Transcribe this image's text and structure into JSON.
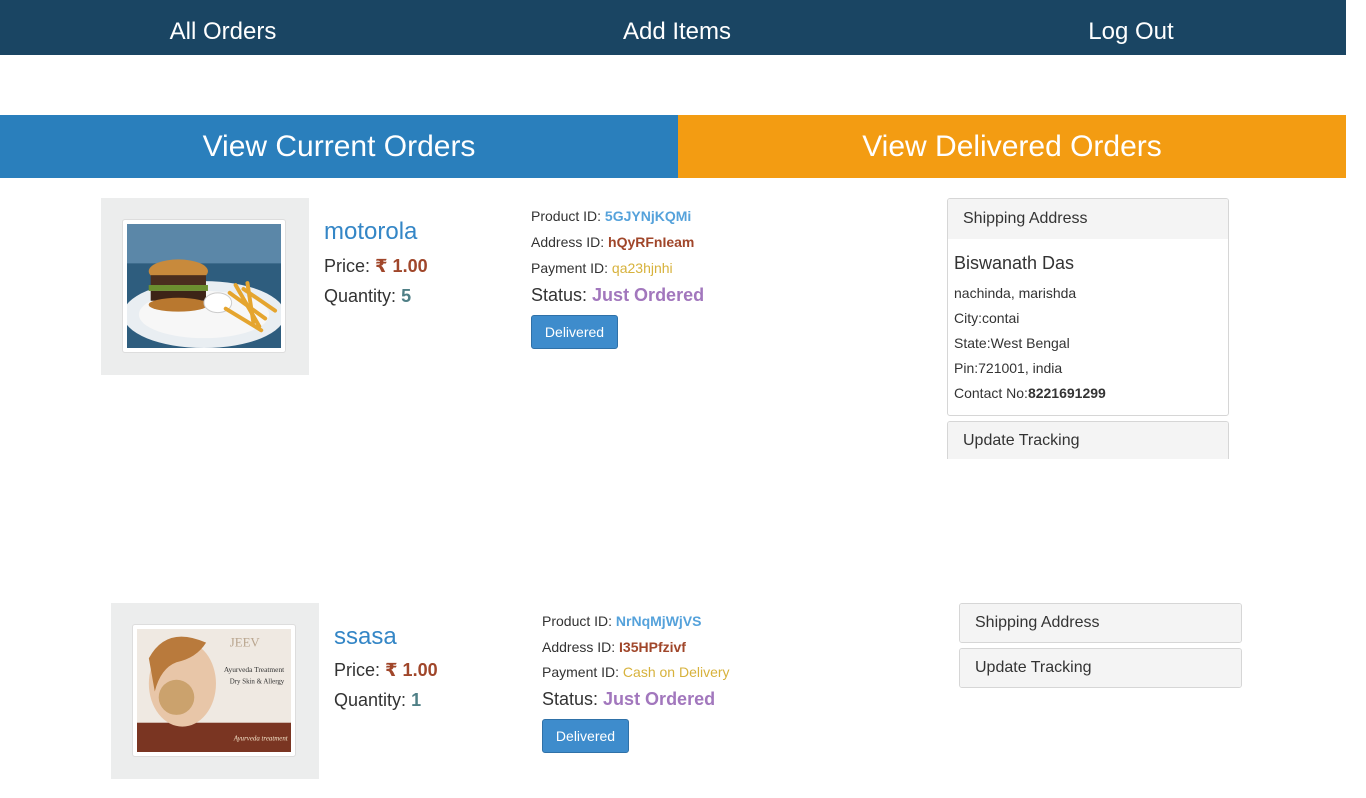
{
  "nav": {
    "all_orders": "All Orders",
    "add_items": "Add Items",
    "log_out": "Log Out"
  },
  "tabs": {
    "current": "View Current Orders",
    "delivered": "View Delivered Orders"
  },
  "labels": {
    "price": "Price:",
    "quantity": "Quantity:",
    "product_id": "Product ID:",
    "address_id": "Address ID:",
    "payment_id": "Payment ID:",
    "status": "Status:",
    "delivered_button": "Delivered",
    "shipping_address": "Shipping Address",
    "update_tracking": "Update Tracking"
  },
  "orders": [
    {
      "name": "motorola",
      "price": "₹ 1.00",
      "quantity": "5",
      "product_id": "5GJYNjKQMi",
      "address_id": "hQyRFnIeam",
      "payment_id": "qa23hjnhi",
      "status": "Just Ordered",
      "image_icon": "burger-fries-photo",
      "shipping": {
        "name": "Biswanath Das",
        "street": "nachinda, marishda",
        "city": "City:contai",
        "state": "State:West Bengal",
        "pin": "Pin:721001, india",
        "contact_label": "Contact No:",
        "contact": "8221691299"
      }
    },
    {
      "name": "ssasa",
      "price": "₹ 1.00",
      "quantity": "1",
      "product_id": "NrNqMjWjVS",
      "address_id": "I35HPfzivf",
      "payment_id": "Cash on Delivery",
      "status": "Just Ordered",
      "image_icon": "ayurveda-poster-photo",
      "image_text": [
        "JEEV",
        "Ayurveda Treatment",
        "Dry Skin & Allergy",
        "Ayurveda treatment"
      ]
    }
  ],
  "colors": {
    "nav_bg": "#1a4563",
    "tab_current": "#2a7fbc",
    "tab_delivered": "#f39c12",
    "link_blue": "#3486c6",
    "price": "#a0462a",
    "status": "#a277bd",
    "button": "#3e8ccc"
  }
}
